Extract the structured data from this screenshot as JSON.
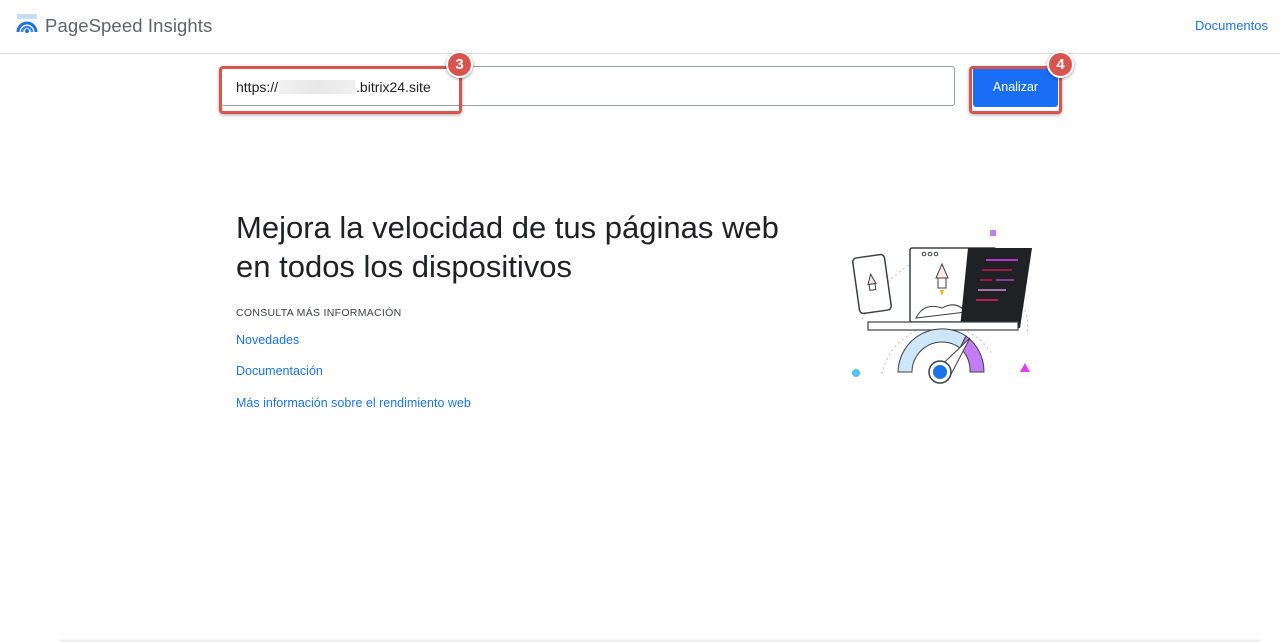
{
  "header": {
    "app_name": "PageSpeed Insights",
    "logo_icon": "pagespeed-logo-icon",
    "docs_link": "Documentos"
  },
  "search": {
    "url_prefix": "https://",
    "url_suffix": ".bitrix24.site",
    "analyze_label": "Analizar"
  },
  "annotations": {
    "step_input": "3",
    "step_button": "4",
    "color": "#d9534f"
  },
  "hero": {
    "headline_line1": "Mejora la velocidad de tus páginas web",
    "headline_line2": "en todos los dispositivos",
    "section_label": "CONSULTA MÁS INFORMACIÓN",
    "links": [
      {
        "label": "Novedades"
      },
      {
        "label": "Documentación"
      },
      {
        "label": "Más información sobre el rendimiento web"
      }
    ],
    "illustration_icon": "devices-speed-illustration"
  },
  "colors": {
    "accent": "#1a73e8",
    "button": "#1a6ef5"
  }
}
